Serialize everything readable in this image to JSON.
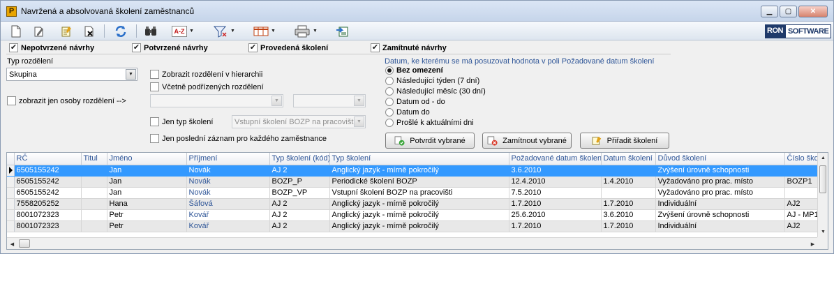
{
  "window": {
    "title": "Navržená a absolvovaná školení zaměstnanců",
    "app_icon_letter": "P",
    "controls": [
      "minimize",
      "maximize",
      "close"
    ]
  },
  "toolbar": {
    "icons": [
      "new-document-icon",
      "edit-icon",
      "notes-icon",
      "delete-icon",
      "refresh-icon",
      "find-icon",
      "sort-az-icon",
      "filter-icon",
      "columns-icon",
      "print-icon",
      "export-icon"
    ],
    "sort_label": "A-Z",
    "brand": {
      "part1": "RON",
      "part2": "SOFTWARE"
    }
  },
  "filters": {
    "nepotvrzene": {
      "label": "Nepotvrzené návrhy",
      "checked": true
    },
    "potvrzene": {
      "label": "Potvrzené návrhy",
      "checked": true
    },
    "provedena": {
      "label": "Provedená školení",
      "checked": true
    },
    "zamitnute": {
      "label": "Zamítnuté návrhy",
      "checked": true
    }
  },
  "left_panel": {
    "typ_rozdeleni_label": "Typ rozdělení",
    "typ_rozdeleni_value": "Skupina",
    "jen_osoby_label": "zobrazit jen osoby rozdělení  -->",
    "jen_osoby_checked": false,
    "hierarchie_label": "Zobrazit rozdělení v hierarchii",
    "hierarchie_checked": false,
    "podrizene_label": "Včetně podřízených rozdělení",
    "podrizene_checked": false,
    "combo_a_value": "",
    "combo_b_value": "",
    "jen_typ_label": "Jen typ školení",
    "jen_typ_checked": false,
    "jen_typ_value": "Vstupní školení BOZP na pracovišti",
    "posledni_label": "Jen poslední záznam pro každého zaměstnance",
    "posledni_checked": false
  },
  "date_panel": {
    "heading": "Datum, ke kterému se má posuzovat hodnota v poli Požadované datum školení",
    "options": [
      {
        "label": "Bez omezení",
        "selected": true
      },
      {
        "label": "Následující týden (7 dní)",
        "selected": false
      },
      {
        "label": "Následující měsíc (30 dní)",
        "selected": false
      },
      {
        "label": "Datum od - do",
        "selected": false
      },
      {
        "label": "Datum do",
        "selected": false
      },
      {
        "label": "Prošlé k aktuálními dni",
        "selected": false
      }
    ]
  },
  "actions": {
    "confirm": "Potvrdit vybrané",
    "reject": "Zamítnout vybrané",
    "assign": "Přiřadit školení"
  },
  "table": {
    "columns": [
      "RČ",
      "Titul",
      "Jméno",
      "Příjmení",
      "Typ školení (kód)",
      "Typ školení",
      "Požadované datum školení",
      "Datum školení",
      "Důvod školení",
      "Číslo školení"
    ],
    "rows": [
      [
        "6505155242",
        "",
        "Jan",
        "Novák",
        "AJ 2",
        "Anglický jazyk - mírně pokročilý",
        "3.6.2010",
        "",
        "Zvýšení úrovně schopnosti",
        ""
      ],
      [
        "6505155242",
        "",
        "Jan",
        "Novák",
        "BOZP_P",
        "Periodické školení BOZP",
        "12.4.2010",
        "1.4.2010",
        "Vyžadováno pro prac. místo",
        "BOZP1"
      ],
      [
        "6505155242",
        "",
        "Jan",
        "Novák",
        "BOZP_VP",
        "Vstupní školení BOZP na pracovišti",
        "7.5.2010",
        "",
        "Vyžadováno pro prac. místo",
        ""
      ],
      [
        "7558205252",
        "",
        "Hana",
        "Šáfová",
        "AJ 2",
        "Anglický jazyk - mírně pokročilý",
        "1.7.2010",
        "1.7.2010",
        "Individuální",
        "AJ2"
      ],
      [
        "8001072323",
        "",
        "Petr",
        "Kovář",
        "AJ 2",
        "Anglický jazyk - mírně pokročilý",
        "25.6.2010",
        "3.6.2010",
        "Zvýšení úrovně schopnosti",
        "AJ - MP1"
      ],
      [
        "8001072323",
        "",
        "Petr",
        "Kovář",
        "AJ 2",
        "Anglický jazyk - mírně pokročilý",
        "1.7.2010",
        "1.7.2010",
        "Individuální",
        "AJ2"
      ]
    ],
    "selected_row": 0
  },
  "colors": {
    "selection": "#3399ff",
    "header_text": "#2e5597",
    "alt_row": "#e8e8e8"
  }
}
